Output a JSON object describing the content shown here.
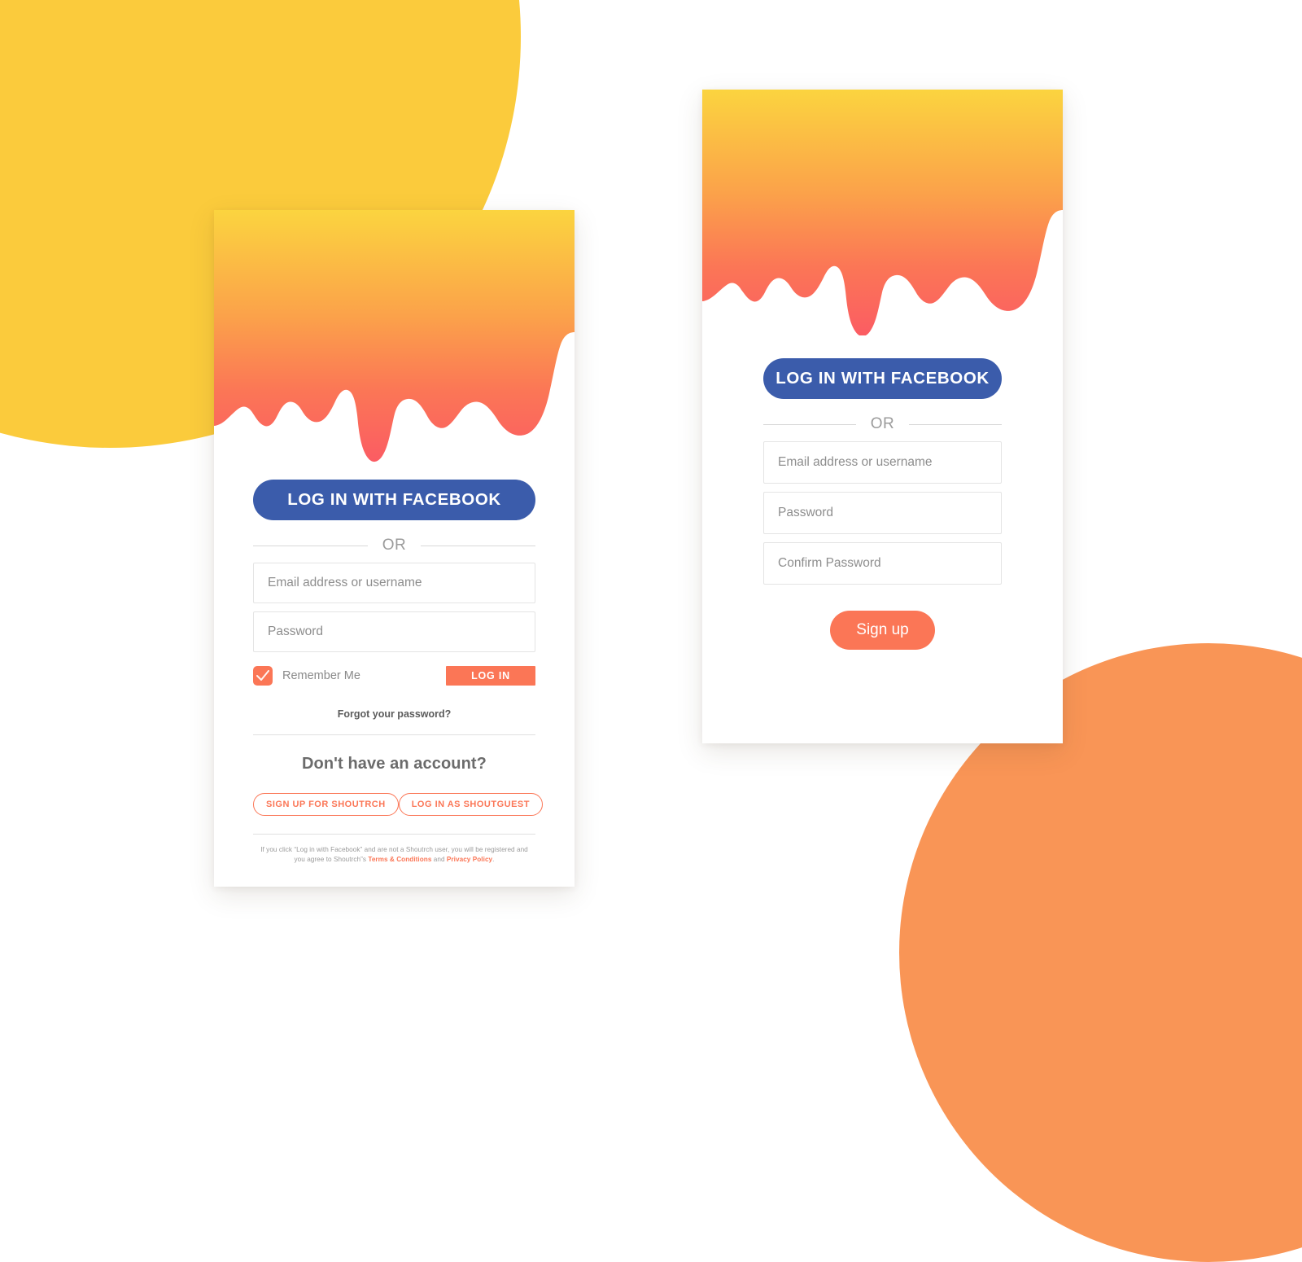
{
  "background": {
    "yellow_blob_color": "#FBCB3C",
    "orange_blob_color": "#F99556",
    "page_color": "#FFFFFF"
  },
  "theme": {
    "facebook_blue": "#3B5CAB",
    "accent_coral": "#FB7656",
    "gradient_top": "#FBD43F",
    "gradient_bottom": "#FB5C63",
    "field_border": "#E4E4E4",
    "muted_text": "#8D8D8D"
  },
  "login_card": {
    "facebook_button_label": "LOG IN WITH FACEBOOK",
    "or_label": "OR",
    "email_field": {
      "value": "",
      "placeholder": "Email address or username"
    },
    "password_field": {
      "value": "",
      "placeholder": "Password"
    },
    "remember_me_label": "Remember Me",
    "remember_me_checked": true,
    "login_button_label": "LOG IN",
    "forgot_password_label": "Forgot your password?",
    "no_account_title": "Don't have an account?",
    "signup_pill_label": "SIGN UP FOR SHOUTRCH",
    "guest_pill_label": "LOG IN AS SHOUTGUEST",
    "fineprint": {
      "line1_before": "If you click “Log in with Facebook” and are not a Shoutrch user, you will be registered and",
      "line2_before": "you agree to Shoutrch”s ",
      "terms_link": "Terms & Conditions",
      "line2_middle": " and ",
      "privacy_link": "Privacy Policy",
      "line2_after": "."
    }
  },
  "signup_card": {
    "facebook_button_label": "LOG IN WITH FACEBOOK",
    "or_label": "OR",
    "email_field": {
      "value": "",
      "placeholder": "Email address or username"
    },
    "password_field": {
      "value": "",
      "placeholder": "Password"
    },
    "confirm_password_field": {
      "value": "",
      "placeholder": "Confirm Password"
    },
    "signup_button_label": "Sign up"
  },
  "icons": {
    "checkmark": "check-icon"
  }
}
